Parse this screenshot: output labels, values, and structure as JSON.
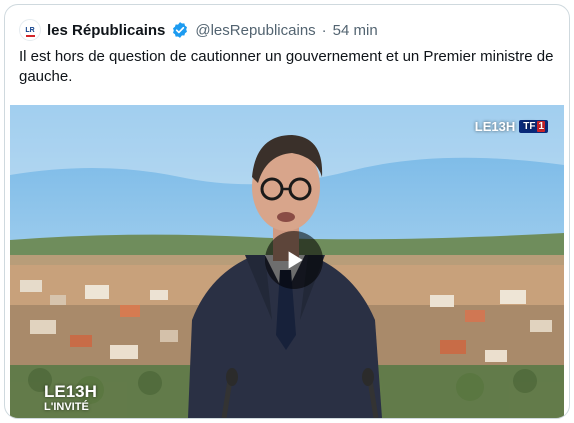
{
  "tweet": {
    "author_name": "les Républicains",
    "handle": "@lesRepublicains",
    "separator": "·",
    "time": "54 min",
    "text": "Il est hors de question de cautionner un gouvernement et un Premier ministre de gauche."
  },
  "media": {
    "channel_show": "LE13H",
    "channel_name": "TF1",
    "show_title": "LE13H",
    "show_subtitle": "L'INVITÉ"
  },
  "colors": {
    "verified": "#1d9bf0",
    "text": "#0f1419",
    "muted": "#536471",
    "border": "#cfd9de"
  },
  "icons": {
    "avatar": "les-republicains-logo",
    "verified": "verified-badge-icon",
    "play": "play-icon"
  }
}
